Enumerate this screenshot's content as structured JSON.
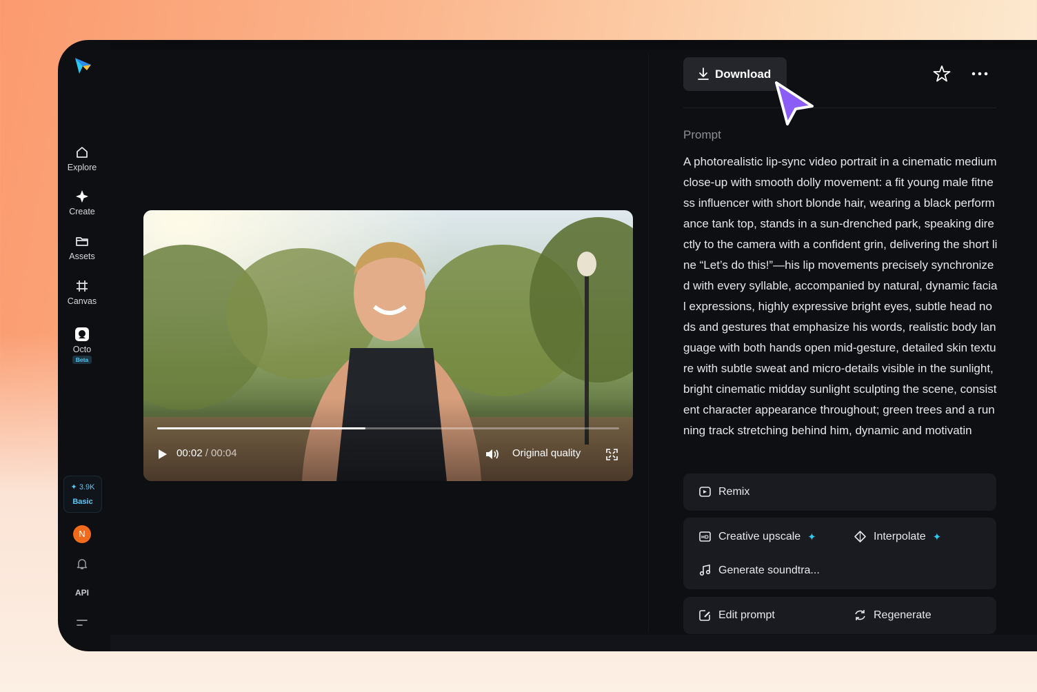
{
  "sidebar": {
    "items": [
      {
        "label": "Explore",
        "icon": "home-icon"
      },
      {
        "label": "Create",
        "icon": "sparkle-icon"
      },
      {
        "label": "Assets",
        "icon": "folder-icon"
      },
      {
        "label": "Canvas",
        "icon": "crop-icon"
      },
      {
        "label": "Octo",
        "icon": "octo-icon",
        "badge": "Beta"
      }
    ],
    "credits": {
      "amount": "3.9K",
      "plan": "Basic"
    },
    "avatar_initial": "N",
    "api_label": "API"
  },
  "video": {
    "current_time": "00:02",
    "duration": "/ 00:04",
    "progress": 0.45,
    "quality_label": "Original quality"
  },
  "panel": {
    "download_label": "Download",
    "prompt_label": "Prompt",
    "prompt_text": "A photorealistic lip-sync video portrait in a cinematic medium close-up with smooth dolly movement: a fit young male fitness influencer with short blonde hair, wearing a black performance tank top, stands in a sun-drenched park, speaking directly to the camera with a confident grin, delivering the short line “Let’s do this!”—his lip movements precisely synchronized with every syllable, accompanied by natural, dynamic facial expressions, highly expressive bright eyes, subtle head nods and gestures that emphasize his words, realistic body language with both hands open mid-gesture, detailed skin texture with subtle sweat and micro-details visible in the sunlight, bright cinematic midday sunlight sculpting the scene, consistent character appearance throughout; green trees and a running track stretching behind him, dynamic and motivatin",
    "actions": {
      "remix": "Remix",
      "creative_upscale": "Creative upscale",
      "interpolate": "Interpolate",
      "generate_soundtrack": "Generate soundtra...",
      "edit_prompt": "Edit prompt",
      "regenerate": "Regenerate"
    }
  },
  "colors": {
    "accent": "#2ec7ee",
    "cursor": "#8b5cf6",
    "avatar": "#f26a1b",
    "background": "#0e0f13"
  }
}
